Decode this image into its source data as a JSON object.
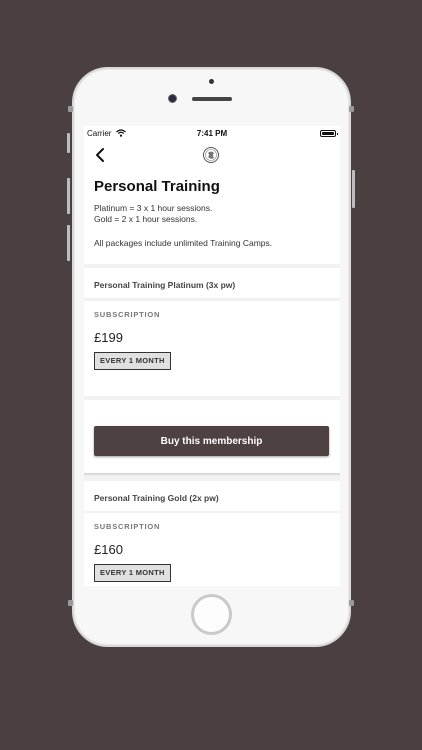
{
  "status": {
    "carrier": "Carrier",
    "time": "7:41 PM"
  },
  "header": {
    "title": "Personal Training",
    "lines": [
      "Platinum = 3 x 1 hour sessions.",
      "Gold = 2 x 1 hour sessions.",
      "All packages include unlimited Training Camps."
    ]
  },
  "plans": [
    {
      "name": "Personal Training Platinum (3x pw)",
      "label": "SUBSCRIPTION",
      "price": "£199",
      "period": "EVERY 1 MONTH",
      "button": "Buy this membership"
    },
    {
      "name": "Personal Training Gold (2x pw)",
      "label": "SUBSCRIPTION",
      "price": "£160",
      "period": "EVERY 1 MONTH"
    }
  ],
  "colors": {
    "background": "#4a4040",
    "button": "#4d4142"
  }
}
